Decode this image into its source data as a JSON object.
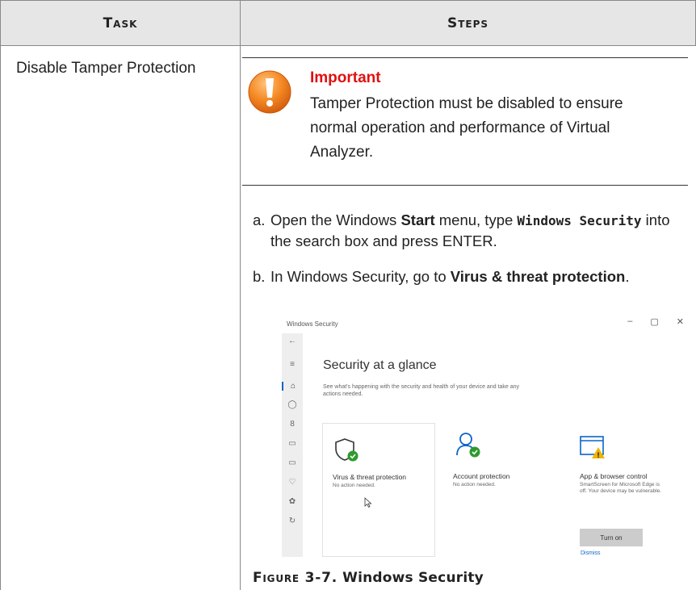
{
  "table": {
    "header_task": "Task",
    "header_steps": "Steps",
    "task_label": "Disable Tamper Protection"
  },
  "important": {
    "title": "Important",
    "text": "Tamper Protection must be disabled to ensure normal operation and performance of Virtual Analyzer.",
    "icon": "warning-exclamation-icon"
  },
  "steps": {
    "a": {
      "letter": "a.",
      "text1": "Open the Windows ",
      "bold1": "Start",
      "text2": " menu, type ",
      "code": "Windows Security",
      "text3": " into the search box and press ENTER."
    },
    "b": {
      "letter": "b.",
      "text1": "In Windows Security, go to ",
      "bold1": "Virus & threat protection",
      "text2": "."
    }
  },
  "screenshot": {
    "window_title": "Windows Security",
    "controls": [
      "–",
      "▢",
      "✕"
    ],
    "heading": "Security at a glance",
    "subtitle": "See what's happening with the security and health of your device and take any actions needed.",
    "cards": [
      {
        "title": "Virus & threat protection",
        "sub": "No action needed.",
        "icon": "shield-check-icon"
      },
      {
        "title": "Account protection",
        "sub": "No action needed.",
        "icon": "person-check-icon"
      },
      {
        "title": "App & browser control",
        "sub": "SmartScreen for Microsoft Edge is off. Your device may be vulnerable.",
        "icon": "browser-warning-icon"
      }
    ],
    "button": "Turn on",
    "link": "Dismiss",
    "accent": "#0a64c8",
    "ok_color": "#2d9a2d",
    "warn_color": "#f0b400"
  },
  "caption": {
    "figure": "Figure 3-7.",
    "title": " Windows Security"
  },
  "colors": {
    "header_bg": "#e6e6e6",
    "important_red": "#e01010",
    "icon_orange": "#f07a1e"
  }
}
